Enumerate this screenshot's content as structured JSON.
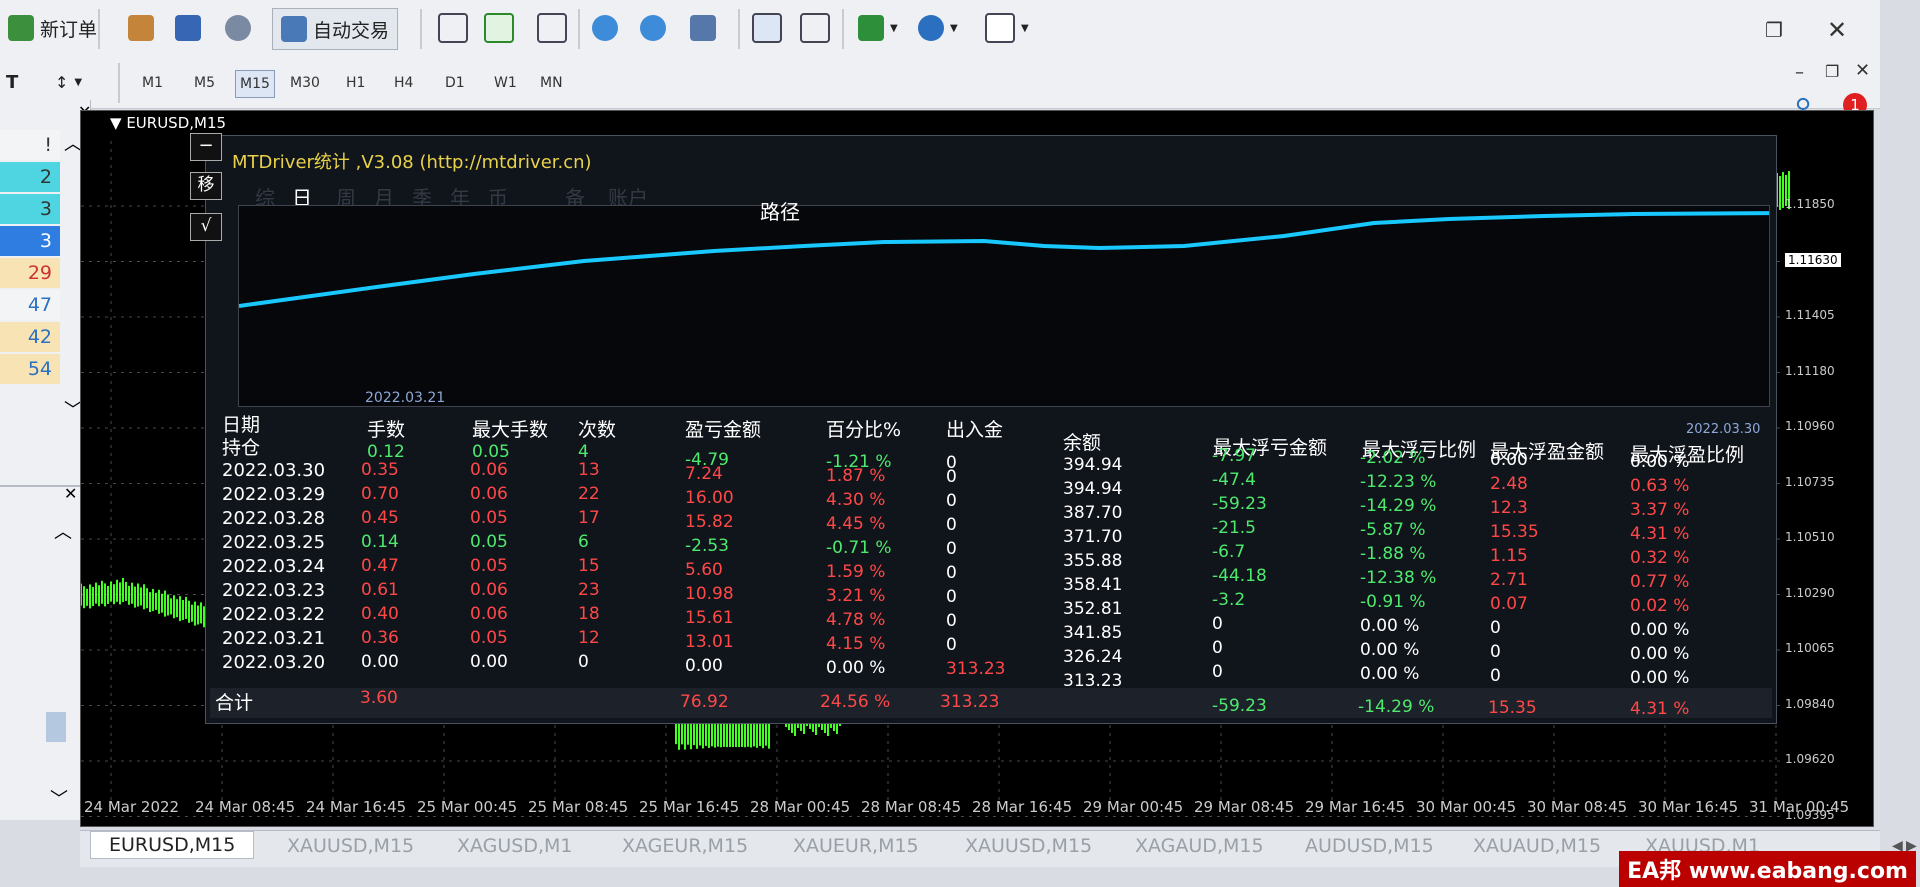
{
  "toolbar": {
    "new_order": "新订单",
    "auto_trade": "自动交易",
    "timeframes": [
      "M1",
      "M5",
      "M15",
      "M30",
      "H1",
      "H4",
      "D1",
      "W1",
      "MN"
    ],
    "selected_timeframe": "M15",
    "alert_count": "1"
  },
  "left_panel": {
    "values": [
      "!",
      "2",
      "3",
      "3",
      "29",
      "47",
      "42",
      "54"
    ]
  },
  "chart": {
    "window_title": "EURUSD,M15",
    "price_labels": [
      "1.11850",
      "1.11630",
      "1.11405",
      "1.11180",
      "1.10960",
      "1.10735",
      "1.10510",
      "1.10290",
      "1.10065",
      "1.09840",
      "1.09620",
      "1.09395"
    ],
    "current_price": "1.11630",
    "time_labels": [
      "24 Mar 2022",
      "24 Mar 08:45",
      "24 Mar 16:45",
      "25 Mar 00:45",
      "25 Mar 08:45",
      "25 Mar 16:45",
      "28 Mar 00:45",
      "28 Mar 08:45",
      "28 Mar 16:45",
      "29 Mar 00:45",
      "29 Mar 08:45",
      "29 Mar 16:45",
      "30 Mar 00:45",
      "30 Mar 08:45",
      "30 Mar 16:45",
      "31 Mar 00:45"
    ]
  },
  "panel": {
    "title": "MTDriver统计 ,V3.08 (http://mtdriver.cn)",
    "side_buttons": [
      "−",
      "移",
      "√"
    ],
    "tabs": [
      "综",
      "日",
      "周",
      "月",
      "季",
      "年",
      "币",
      "",
      "备",
      "账户"
    ],
    "active_tab": "日",
    "path_label": "路径",
    "path_start_date": "2022.03.21",
    "path_end_date": "2022.03.30",
    "headers": {
      "date": "日期",
      "holding": "持仓",
      "lots": "手数",
      "max_lots": "最大手数",
      "count": "次数",
      "pnl": "盈亏金额",
      "percent": "百分比%",
      "deposit": "出入金",
      "balance": "余额",
      "max_float_loss": "最大浮亏金额",
      "max_float_loss_ratio": "最大浮亏比例",
      "max_float_profit": "最大浮盈金额",
      "max_float_profit_ratio": "最大浮盈比例"
    },
    "holding_row": {
      "lots": "0.12",
      "max_lots": "0.05",
      "count": "4",
      "pnl": "-4.79",
      "percent": "-1.21 %",
      "deposit": "0"
    },
    "rows": [
      {
        "date": "2022.03.30",
        "lots": "0.35",
        "max_lots": "0.06",
        "count": "13",
        "pnl": "7.24",
        "percent": "1.87 %",
        "deposit": "0",
        "balance": "394.94",
        "mfl": "-7.97",
        "mflr": "-2.02 %",
        "mfp": "0.00",
        "mfpr": "0.00 %",
        "c": "r"
      },
      {
        "date": "2022.03.29",
        "lots": "0.70",
        "max_lots": "0.06",
        "count": "22",
        "pnl": "16.00",
        "percent": "4.30 %",
        "deposit": "0",
        "balance": "394.94",
        "mfl": "-47.4",
        "mflr": "-12.23 %",
        "mfp": "2.48",
        "mfpr": "0.63 %",
        "c": "r"
      },
      {
        "date": "2022.03.28",
        "lots": "0.45",
        "max_lots": "0.05",
        "count": "17",
        "pnl": "15.82",
        "percent": "4.45 %",
        "deposit": "0",
        "balance": "387.70",
        "mfl": "-59.23",
        "mflr": "-14.29 %",
        "mfp": "12.3",
        "mfpr": "3.37 %",
        "c": "r"
      },
      {
        "date": "2022.03.25",
        "lots": "0.14",
        "max_lots": "0.05",
        "count": "6",
        "pnl": "-2.53",
        "percent": "-0.71 %",
        "deposit": "0",
        "balance": "371.70",
        "mfl": "-21.5",
        "mflr": "-5.87 %",
        "mfp": "15.35",
        "mfpr": "4.31 %",
        "c": "g"
      },
      {
        "date": "2022.03.24",
        "lots": "0.47",
        "max_lots": "0.05",
        "count": "15",
        "pnl": "5.60",
        "percent": "1.59 %",
        "deposit": "0",
        "balance": "355.88",
        "mfl": "-6.7",
        "mflr": "-1.88 %",
        "mfp": "1.15",
        "mfpr": "0.32 %",
        "c": "r"
      },
      {
        "date": "2022.03.23",
        "lots": "0.61",
        "max_lots": "0.06",
        "count": "23",
        "pnl": "10.98",
        "percent": "3.21 %",
        "deposit": "0",
        "balance": "358.41",
        "mfl": "-44.18",
        "mflr": "-12.38 %",
        "mfp": "2.71",
        "mfpr": "0.77 %",
        "c": "r"
      },
      {
        "date": "2022.03.22",
        "lots": "0.40",
        "max_lots": "0.06",
        "count": "18",
        "pnl": "15.61",
        "percent": "4.78 %",
        "deposit": "0",
        "balance": "352.81",
        "mfl": "-3.2",
        "mflr": "-0.91 %",
        "mfp": "0.07",
        "mfpr": "0.02 %",
        "c": "r"
      },
      {
        "date": "2022.03.21",
        "lots": "0.36",
        "max_lots": "0.05",
        "count": "12",
        "pnl": "13.01",
        "percent": "4.15 %",
        "deposit": "0",
        "balance": "341.85",
        "mfl": "0",
        "mflr": "0.00 %",
        "mfp": "0",
        "mfpr": "0.00 %",
        "c": "r"
      },
      {
        "date": "2022.03.20",
        "lots": "0.00",
        "max_lots": "0.00",
        "count": "0",
        "pnl": "0.00",
        "percent": "0.00 %",
        "deposit": "313.23",
        "balance": "326.24",
        "mfl": "0",
        "mflr": "0.00 %",
        "mfp": "0",
        "mfpr": "0.00 %",
        "c": "w"
      }
    ],
    "extra_balance": "313.23",
    "extra_zero_row": {
      "mfl": "0",
      "mflr": "0.00 %",
      "mfp": "0",
      "mfpr": "0.00 %"
    },
    "total": {
      "label": "合计",
      "lots": "3.60",
      "pnl": "76.92",
      "percent": "24.56 %",
      "deposit": "313.23",
      "mfl": "-59.23",
      "mflr": "-14.29 %",
      "mfp": "15.35",
      "mfpr": "4.31 %"
    }
  },
  "symbol_tabs": [
    "EURUSD,M15",
    "XAUUSD,M15",
    "XAGUSD,M1",
    "XAGEUR,M15",
    "XAUEUR,M15",
    "XAUUSD,M15",
    "XAGAUD,M15",
    "AUDUSD,M15",
    "XAUAUD,M15",
    "XAUUSD,M1"
  ],
  "active_symbol_tab": "EURUSD,M15",
  "watermark": "EA邦 www.eabang.com",
  "colors": {
    "equity_line": "#18c8ff",
    "profit": "#4eea6e",
    "loss": "#ff4848",
    "candles": "#44ff22"
  }
}
